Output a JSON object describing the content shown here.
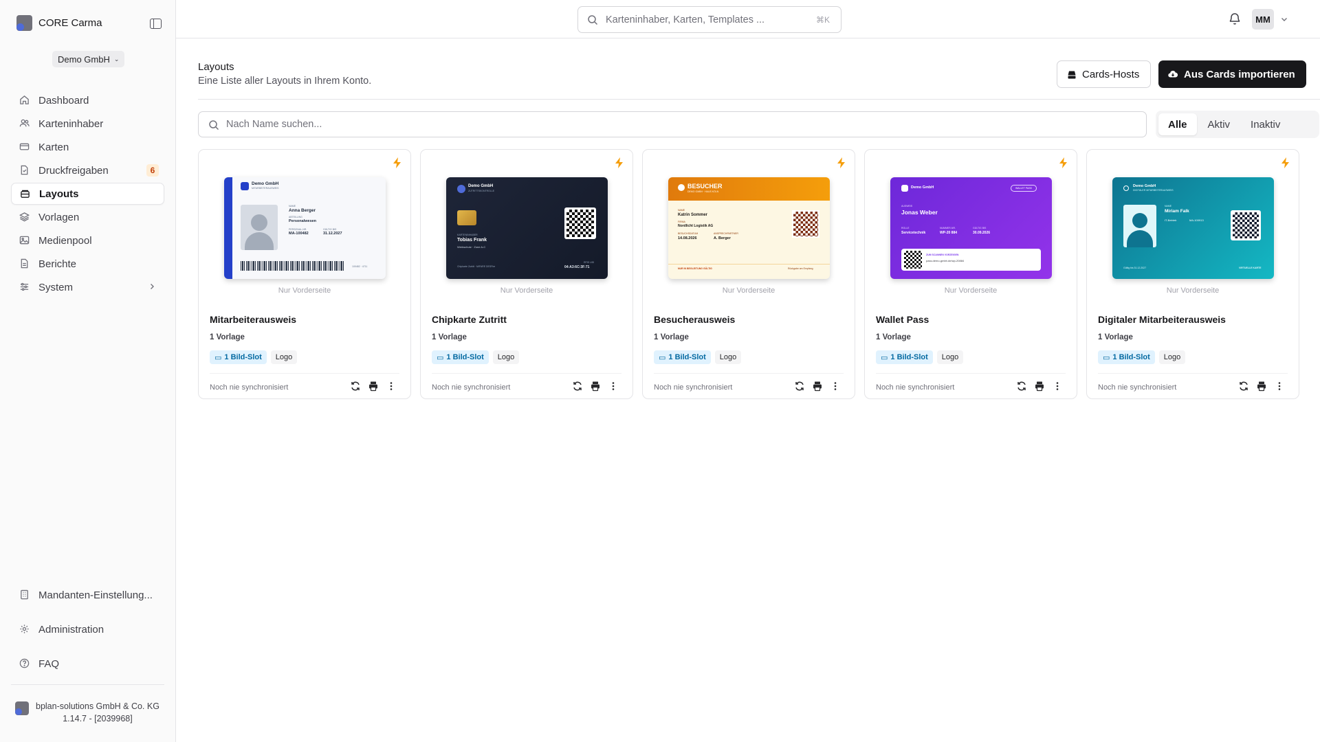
{
  "sidebar": {
    "app_name": "CORE Carma",
    "tenant": "Demo GmbH",
    "items": [
      {
        "label": "Dashboard",
        "icon": "home-icon"
      },
      {
        "label": "Karteninhaber",
        "icon": "users-icon"
      },
      {
        "label": "Karten",
        "icon": "credit-card-icon"
      },
      {
        "label": "Druckfreigaben",
        "icon": "file-check-icon",
        "badge": "6"
      },
      {
        "label": "Layouts",
        "icon": "layout-icon",
        "active": true
      },
      {
        "label": "Vorlagen",
        "icon": "layers-icon"
      },
      {
        "label": "Medienpool",
        "icon": "image-icon"
      },
      {
        "label": "Berichte",
        "icon": "file-text-icon"
      },
      {
        "label": "System",
        "icon": "sliders-icon",
        "has_submenu": true
      }
    ],
    "bottom": {
      "tenant_settings": "Mandanten-Einstellung...",
      "administration": "Administration",
      "faq": "FAQ"
    },
    "footer": {
      "company": "bplan-solutions GmbH & Co. KG",
      "version": "1.14.7 - [2039968]"
    }
  },
  "topbar": {
    "search_placeholder": "Karteninhaber, Karten, Templates ...",
    "shortcut": "⌘K",
    "user_initials": "MM"
  },
  "header": {
    "title": "Layouts",
    "subtitle": "Eine Liste aller Layouts in Ihrem Konto.",
    "cards_hosts_label": "Cards-Hosts",
    "import_label": "Aus Cards importieren"
  },
  "filter": {
    "search_placeholder": "Nach Name suchen...",
    "tabs": [
      "Alle",
      "Aktiv",
      "Inaktiv"
    ],
    "active_tab": "Alle"
  },
  "colors": {
    "accent": "#18181b",
    "bolt": "#f59e0b",
    "badge": "#c2410c"
  },
  "cards": [
    {
      "name": "Mitarbeiterausweis",
      "front_label": "Nur Vorderseite",
      "templates": "1 Vorlage",
      "chip_slot": "1 Bild-Slot",
      "chip_logo": "Logo",
      "sync": "Noch nie synchronisiert",
      "preview": {
        "company": "Demo GmbH",
        "subtitle": "MITARBEITERAUSWEIS",
        "name_label": "NAME",
        "name": "Anna Berger",
        "dept_label": "ABTEILUNG",
        "dept": "Personalwesen",
        "id_label": "PERSONAL-NR.",
        "id": "MA-100482",
        "valid_label": "GÜLTIG BIS",
        "valid": "31.12.2027",
        "code": "100482 · 4711"
      }
    },
    {
      "name": "Chipkarte Zutritt",
      "front_label": "Nur Vorderseite",
      "templates": "1 Vorlage",
      "chip_slot": "1 Bild-Slot",
      "chip_logo": "Logo",
      "sync": "Noch nie synchronisiert",
      "preview": {
        "company": "Demo GmbH",
        "subtitle": "ZUTRITTSKONTROLLE",
        "holder_label": "KARTENINHABER",
        "holder": "Tobias Frank",
        "zone": "Werkschutz · Zone A-C",
        "footer": "Chipkarte Zutritt · MIFARE DESFire",
        "uid_label": "RFID UID",
        "uid": "04:A3:6C:3F:71"
      }
    },
    {
      "name": "Besucherausweis",
      "front_label": "Nur Vorderseite",
      "templates": "1 Vorlage",
      "chip_slot": "1 Bild-Slot",
      "chip_logo": "Logo",
      "sync": "Noch nie synchronisiert",
      "preview": {
        "header": "BESUCHER",
        "sub": "DEMO GMBH · HAUS KÖLN",
        "name_label": "NAME",
        "name": "Katrin Sommer",
        "company_label": "FIRMA",
        "company": "Nordlicht Logistik AG",
        "date_label": "BESUCHSDATUM",
        "date": "14.08.2026",
        "contact_label": "ANSPRECHPARTNER",
        "contact": "A. Berger",
        "footer_left": "NUR IN BEGLEITUNG GÜLTIG",
        "footer_right": "Rückgabe am Empfang"
      }
    },
    {
      "name": "Wallet Pass",
      "front_label": "Nur Vorderseite",
      "templates": "1 Vorlage",
      "chip_slot": "1 Bild-Slot",
      "chip_logo": "Logo",
      "sync": "Noch nie synchronisiert",
      "preview": {
        "company": "Demo GmbH",
        "tag": "WALLET PASS",
        "name_label": "AUSWEIS",
        "name": "Jonas Weber",
        "role_label": "ROLLE",
        "role": "Servicetechnik",
        "num_label": "NUMMER-NR.",
        "num": "WP-20 884",
        "valid_label": "GÜLTIG BIS",
        "valid": "30.09.2026",
        "scan_label": "ZUM SCANNEN VORZEIGEN",
        "url": "pass.demo-gmbh.de/wp-20884"
      }
    },
    {
      "name": "Digitaler Mitarbeiterausweis",
      "front_label": "Nur Vorderseite",
      "templates": "1 Vorlage",
      "chip_slot": "1 Bild-Slot",
      "chip_logo": "Logo",
      "sync": "Noch nie synchronisiert",
      "preview": {
        "company": "Demo GmbH",
        "subtitle": "DIGITALER MITARBEITERAUSWEIS",
        "name_label": "NAME",
        "name": "Miriam Falk",
        "dept": "IT-Betrieb",
        "id": "MA-100913",
        "footer_left": "Gültig bis 31.12.2027",
        "footer_right": "VIRTUELLE KARTE"
      }
    }
  ]
}
